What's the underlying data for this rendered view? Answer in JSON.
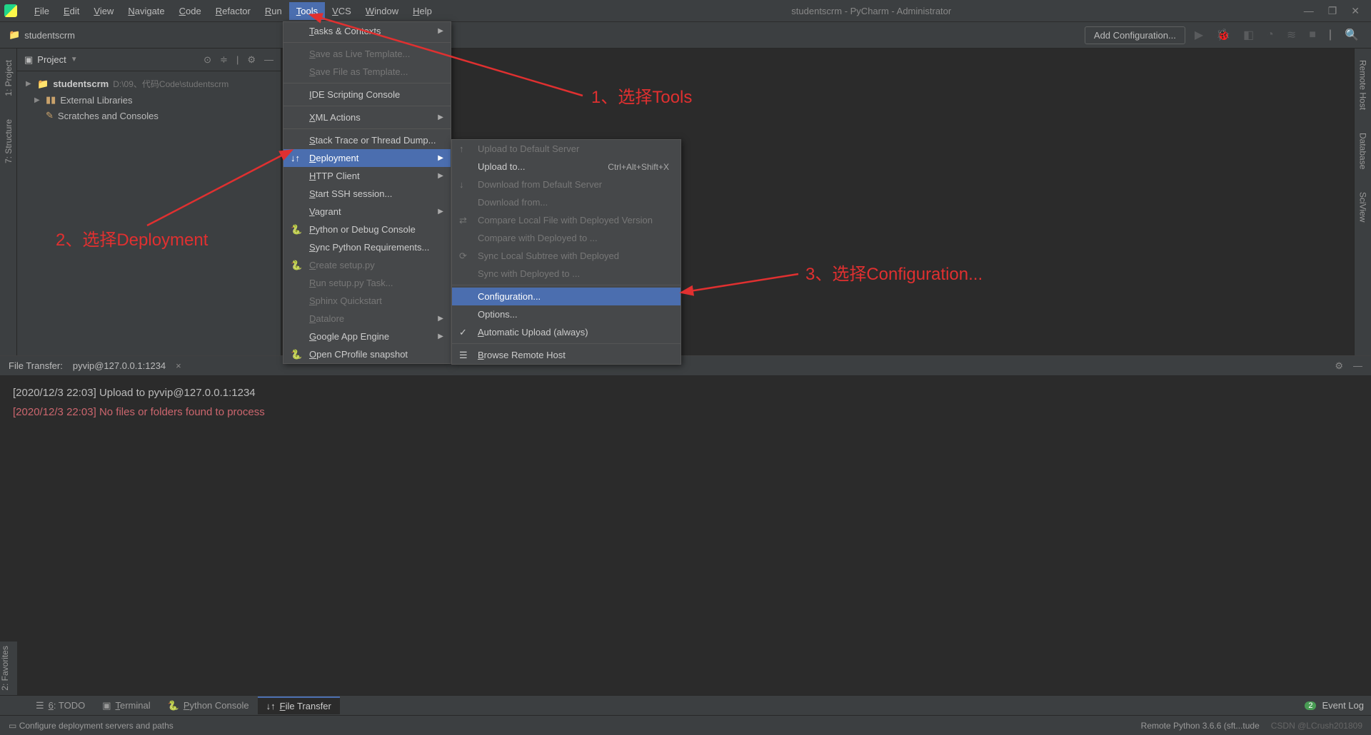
{
  "menubar": [
    "File",
    "Edit",
    "View",
    "Navigate",
    "Code",
    "Refactor",
    "Run",
    "Tools",
    "VCS",
    "Window",
    "Help"
  ],
  "active_menu_index": 7,
  "window_title": "studentscrm - PyCharm - Administrator",
  "breadcrumb": "studentscrm",
  "add_config": "Add Configuration...",
  "project_panel": {
    "title": "Project",
    "root": {
      "name": "studentscrm",
      "path": "D:\\09、代码Code\\studentscrm"
    },
    "ext_lib": "External Libraries",
    "scratch": "Scratches and Consoles"
  },
  "left_tabs": [
    "1: Project",
    "7: Structure"
  ],
  "right_tabs": [
    "Remote Host",
    "Database",
    "SciView"
  ],
  "tools_menu": [
    {
      "label": "Tasks & Contexts",
      "sub": true
    },
    {
      "sep": true
    },
    {
      "label": "Save as Live Template...",
      "disabled": true
    },
    {
      "label": "Save File as Template...",
      "disabled": true
    },
    {
      "sep": true
    },
    {
      "label": "IDE Scripting Console"
    },
    {
      "sep": true
    },
    {
      "label": "XML Actions",
      "sub": true
    },
    {
      "sep": true
    },
    {
      "label": "Stack Trace or Thread Dump..."
    },
    {
      "label": "Deployment",
      "sub": true,
      "selected": true,
      "icon": "↓↑"
    },
    {
      "label": "HTTP Client",
      "sub": true
    },
    {
      "label": "Start SSH session..."
    },
    {
      "label": "Vagrant",
      "sub": true
    },
    {
      "label": "Python or Debug Console",
      "icon": "🐍"
    },
    {
      "label": "Sync Python Requirements..."
    },
    {
      "label": "Create setup.py",
      "disabled": true,
      "icon": "🐍"
    },
    {
      "label": "Run setup.py Task...",
      "disabled": true
    },
    {
      "label": "Sphinx Quickstart",
      "disabled": true
    },
    {
      "label": "Datalore",
      "sub": true,
      "disabled": true
    },
    {
      "label": "Google App Engine",
      "sub": true
    },
    {
      "label": "Open CProfile snapshot",
      "icon": "🐍"
    }
  ],
  "deploy_menu": [
    {
      "label": "Upload to Default Server",
      "disabled": true,
      "icon": "↑"
    },
    {
      "label": "Upload to...",
      "shortcut": "Ctrl+Alt+Shift+X"
    },
    {
      "label": "Download from Default Server",
      "disabled": true,
      "icon": "↓"
    },
    {
      "label": "Download from...",
      "disabled": true
    },
    {
      "label": "Compare Local File with Deployed Version",
      "disabled": true,
      "icon": "⇄"
    },
    {
      "label": "Compare with Deployed to ...",
      "disabled": true
    },
    {
      "label": "Sync Local Subtree with Deployed",
      "disabled": true,
      "icon": "⟳"
    },
    {
      "label": "Sync with Deployed to ...",
      "disabled": true
    },
    {
      "sep": true
    },
    {
      "label": "Configuration...",
      "selected": true
    },
    {
      "label": "Options..."
    },
    {
      "label": "Automatic Upload (always)",
      "icon": "✓"
    },
    {
      "sep": true
    },
    {
      "label": "Browse Remote Host",
      "icon": "☰"
    }
  ],
  "bottom_panel": {
    "label": "File Transfer:",
    "tab": "pyvip@127.0.0.1:1234",
    "log1": "[2020/12/3 22:03] Upload to pyvip@127.0.0.1:1234",
    "log2": "[2020/12/3 22:03] No files or folders found to process"
  },
  "left_bottom_tab": "2: Favorites",
  "bottom_tabs": [
    {
      "label": "6: TODO",
      "icon": "☰"
    },
    {
      "label": "Terminal",
      "icon": "▣"
    },
    {
      "label": "Python Console",
      "icon": "🐍"
    },
    {
      "label": "File Transfer",
      "icon": "↓↑",
      "active": true
    }
  ],
  "event_log": "Event Log",
  "event_badge": "2",
  "status_left": "Configure deployment servers and paths",
  "status_right": "Remote Python 3.6.6 (sft...tude",
  "watermark": "CSDN @LCrush201809",
  "annotations": {
    "a1": "1、选择Tools",
    "a2": "2、选择Deployment",
    "a3": "3、选择Configuration..."
  }
}
